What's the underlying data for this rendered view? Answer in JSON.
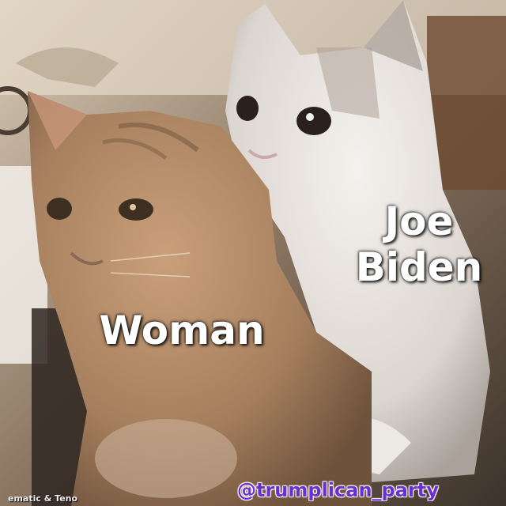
{
  "captions": {
    "joe": "Joe\nBiden",
    "woman": "Woman"
  },
  "watermark": {
    "handle": "@trumplican_party",
    "credit": "ematic & Teno"
  },
  "colors": {
    "caption_text": "#ffffff",
    "handle_text": "#6a2fd0",
    "orange_cat": "#b8906a",
    "white_cat": "#e8e4e0",
    "background": "#6b5a4a"
  }
}
